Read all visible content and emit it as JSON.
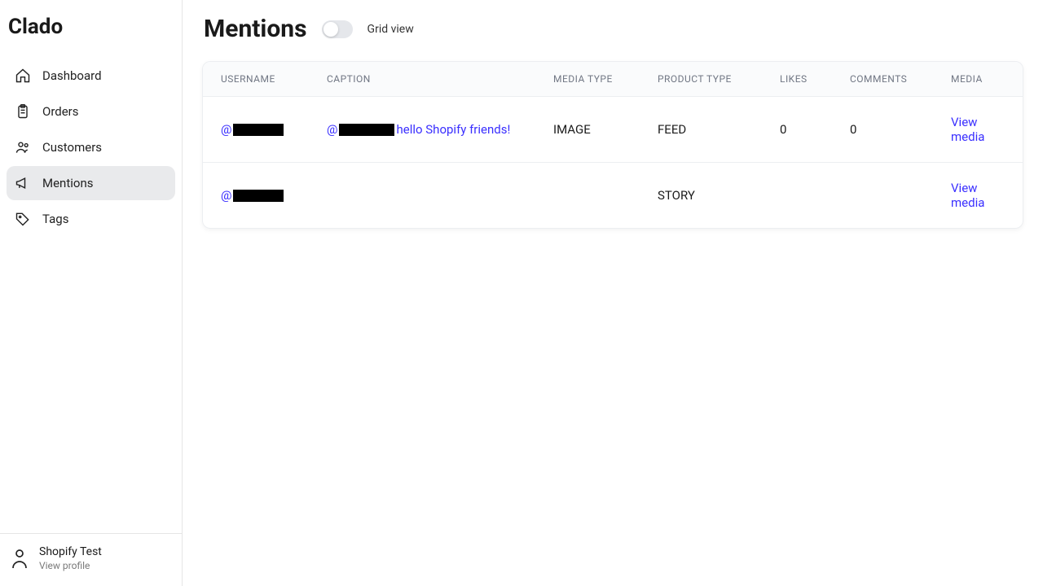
{
  "brand": "Clado",
  "nav": [
    {
      "key": "dashboard",
      "label": "Dashboard"
    },
    {
      "key": "orders",
      "label": "Orders"
    },
    {
      "key": "customers",
      "label": "Customers"
    },
    {
      "key": "mentions",
      "label": "Mentions"
    },
    {
      "key": "tags",
      "label": "Tags"
    }
  ],
  "active_nav": "mentions",
  "footer": {
    "name": "Shopify Test",
    "view_profile": "View profile"
  },
  "page": {
    "title": "Mentions",
    "toggle_label": "Grid view"
  },
  "table": {
    "columns": {
      "username": "USERNAME",
      "caption": "CAPTION",
      "media_type": "MEDIA TYPE",
      "product_type": "PRODUCT TYPE",
      "likes": "LIKES",
      "comments": "COMMENTS",
      "media": "MEDIA"
    },
    "rows": [
      {
        "username_prefix": "@",
        "caption_prefix": "@",
        "caption_suffix": " hello Shopify friends!",
        "media_type": "IMAGE",
        "product_type": "FEED",
        "likes": "0",
        "comments": "0",
        "action": "View media"
      },
      {
        "username_prefix": "@",
        "caption_prefix": "",
        "caption_suffix": "",
        "media_type": "",
        "product_type": "STORY",
        "likes": "",
        "comments": "",
        "action": "View media"
      }
    ]
  }
}
